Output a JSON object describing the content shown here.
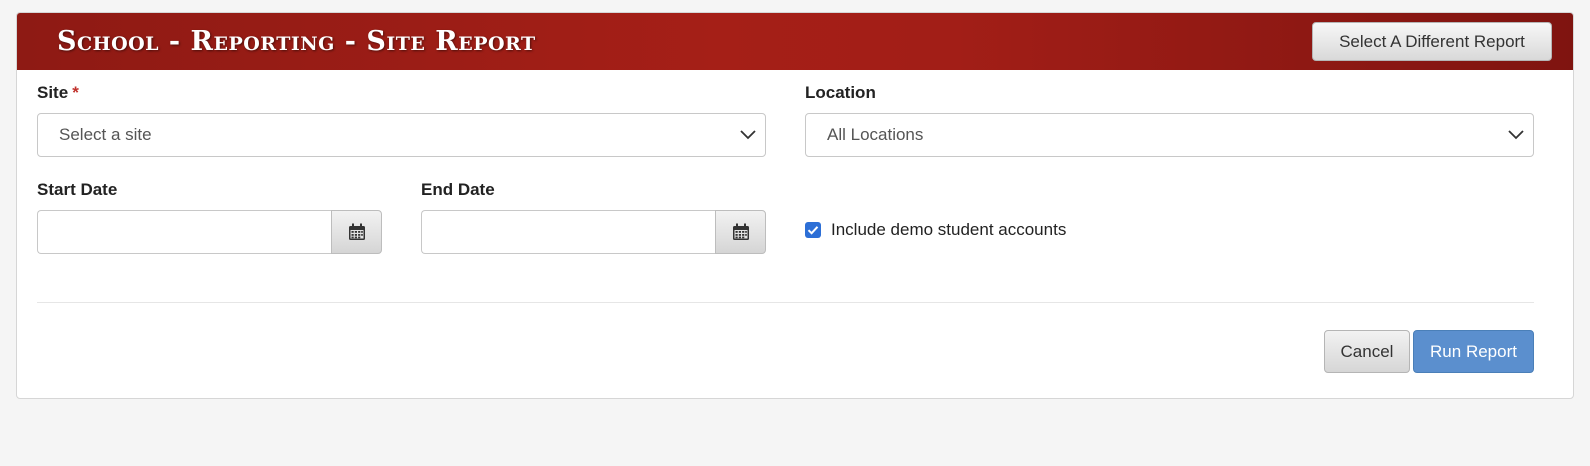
{
  "header": {
    "title": "School - Reporting - Site Report",
    "change_report_label": "Select A Different Report"
  },
  "form": {
    "site": {
      "label": "Site",
      "required_mark": "*",
      "value": "Select a site"
    },
    "location": {
      "label": "Location",
      "value": "All Locations"
    },
    "start_date": {
      "label": "Start Date",
      "value": ""
    },
    "end_date": {
      "label": "End Date",
      "value": ""
    },
    "include_demo": {
      "label": "Include demo student accounts",
      "checked": true
    }
  },
  "actions": {
    "cancel_label": "Cancel",
    "run_label": "Run Report"
  },
  "colors": {
    "header_bg": "#a51f17",
    "primary_button": "#5b8fce",
    "checkbox": "#2d6fd6",
    "required": "#c0302a"
  },
  "icons": {
    "select_arrow": "chevron-down-icon",
    "date_picker": "calendar-icon",
    "checkbox_mark": "check-icon"
  }
}
